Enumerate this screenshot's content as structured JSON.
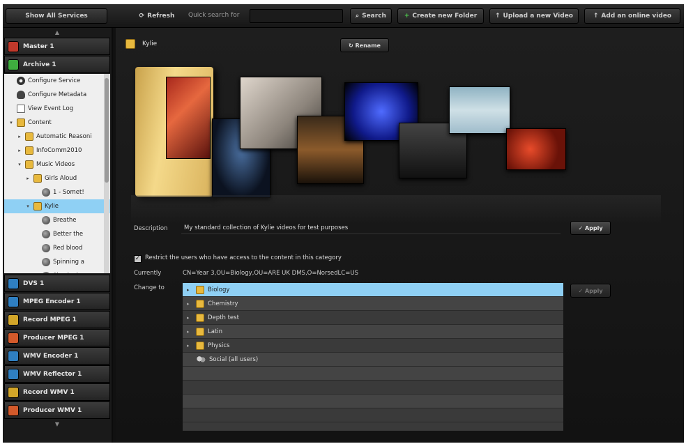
{
  "topbar": {
    "show_all_services": "Show All Services",
    "refresh_label": "Refresh",
    "quick_search_label": "Quick search for",
    "search_value": "",
    "search_label": "Search",
    "create_folder_label": "Create new Folder",
    "upload_label": "Upload a new Video",
    "add_online_label": "Add an online video"
  },
  "sidebar": {
    "services_top": [
      {
        "label": "Master 1",
        "color": "#c0392b"
      },
      {
        "label": "Archive 1",
        "color": "#3fae3f"
      }
    ],
    "tree": [
      {
        "label": "Configure Service",
        "icon": "gear-icon",
        "indent": 0,
        "exp": ""
      },
      {
        "label": "Configure Metadata",
        "icon": "lightbulb-icon",
        "indent": 0,
        "exp": ""
      },
      {
        "label": "View Event Log",
        "icon": "document-icon",
        "indent": 0,
        "exp": ""
      },
      {
        "label": "Content",
        "icon": "folder-icon",
        "indent": 0,
        "exp": "▾"
      },
      {
        "label": "Automatic Reasoni",
        "icon": "folder-icon",
        "indent": 1,
        "exp": "▸"
      },
      {
        "label": "InfoComm2010",
        "icon": "folder-icon",
        "indent": 1,
        "exp": "▸"
      },
      {
        "label": "Music Videos",
        "icon": "folder-icon",
        "indent": 1,
        "exp": "▾"
      },
      {
        "label": "Girls Aloud",
        "icon": "folder-icon",
        "indent": 2,
        "exp": "▸"
      },
      {
        "label": "1 - Somet!",
        "icon": "video-icon",
        "indent": 3,
        "exp": ""
      },
      {
        "label": "Kylie",
        "icon": "folder-icon",
        "indent": 2,
        "exp": "▾",
        "selected": true
      },
      {
        "label": "Breathe",
        "icon": "video-icon",
        "indent": 3,
        "exp": ""
      },
      {
        "label": "Better the",
        "icon": "video-icon",
        "indent": 3,
        "exp": ""
      },
      {
        "label": "Red blood",
        "icon": "video-icon",
        "indent": 3,
        "exp": ""
      },
      {
        "label": "Spinning a",
        "icon": "video-icon",
        "indent": 3,
        "exp": ""
      },
      {
        "label": "Shocked",
        "icon": "video-icon",
        "indent": 3,
        "exp": ""
      }
    ],
    "services_bottom": [
      {
        "label": "DVS 1",
        "color": "#2f7fc1"
      },
      {
        "label": "MPEG Encoder 1",
        "color": "#2f7fc1"
      },
      {
        "label": "Record MPEG 1",
        "color": "#d3a629"
      },
      {
        "label": "Producer MPEG 1",
        "color": "#d35a2b"
      },
      {
        "label": "WMV Encoder 1",
        "color": "#2f7fc1"
      },
      {
        "label": "WMV Reflector 1",
        "color": "#2f7fc1"
      },
      {
        "label": "Record WMV 1",
        "color": "#d3a629"
      },
      {
        "label": "Producer WMV 1",
        "color": "#d35a2b"
      }
    ]
  },
  "main": {
    "folder_title": "Kylie",
    "rename_label": "Rename",
    "description_label": "Description",
    "description_value": "My standard collection of Kylie videos for test purposes",
    "apply_label": "Apply",
    "restrict_label": "Restrict the users who have access to the content in this category",
    "restrict_checked": true,
    "currently_label": "Currently",
    "currently_value": "CN=Year 3,OU=Biology,OU=ARE UK DMS,O=NorsedLC=US",
    "change_to_label": "Change to",
    "apply_disabled_label": "Apply",
    "groups": [
      {
        "label": "Biology",
        "icon": "folder-icon",
        "selected": true
      },
      {
        "label": "Chemistry",
        "icon": "folder-icon"
      },
      {
        "label": "Depth test",
        "icon": "folder-icon"
      },
      {
        "label": "Latin",
        "icon": "folder-icon"
      },
      {
        "label": "Physics",
        "icon": "folder-icon"
      },
      {
        "label": "Social (all users)",
        "icon": "users-icon"
      }
    ]
  }
}
